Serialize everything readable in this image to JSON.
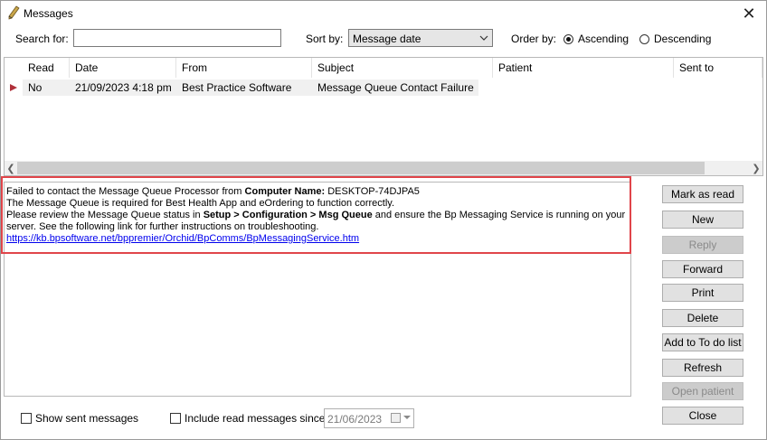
{
  "window": {
    "title": "Messages"
  },
  "filters": {
    "search_label": "Search for:",
    "search_value": "",
    "sort_label": "Sort by:",
    "sort_value": "Message date",
    "order_label": "Order by:",
    "ascending_label": "Ascending",
    "descending_label": "Descending",
    "order_selected": "Ascending"
  },
  "grid": {
    "columns": [
      "Read",
      "Date",
      "From",
      "Subject",
      "Patient",
      "Sent to"
    ],
    "rows": [
      {
        "read": "No",
        "date": "21/09/2023 4:18 pm",
        "from": "Best Practice Software",
        "subject": "Message Queue Contact Failure",
        "patient": "",
        "sent_to": ""
      }
    ]
  },
  "message": {
    "line1_prefix": "Failed to contact the Message Queue Processor from ",
    "line1_bold": "Computer Name:",
    "line1_value": " DESKTOP-74DJPA5",
    "line2": "The Message Queue is required for Best Health App and eOrdering to function correctly.",
    "line3_prefix": "Please review the Message Queue status in ",
    "line3_bold": "Setup > Configuration > Msg Queue",
    "line3_suffix": " and ensure the Bp Messaging Service is running on your",
    "line4": "server. See the following link for further instructions on troubleshooting.",
    "link": "https://kb.bpsoftware.net/bppremier/Orchid/BpComms/BpMessagingService.htm"
  },
  "buttons": {
    "mark_as_read": "Mark as read",
    "new": "New",
    "reply": "Reply",
    "forward": "Forward",
    "print": "Print",
    "delete": "Delete",
    "add_to_do": "Add to To do list",
    "refresh": "Refresh",
    "open_patient": "Open patient",
    "close": "Close"
  },
  "footer": {
    "show_sent_label": "Show sent messages",
    "include_read_label": "Include read messages since",
    "since_date": "21/06/2023"
  },
  "colors": {
    "highlight": "#e0454a",
    "row_indicator": "#b0303a",
    "link": "#0000ee"
  }
}
